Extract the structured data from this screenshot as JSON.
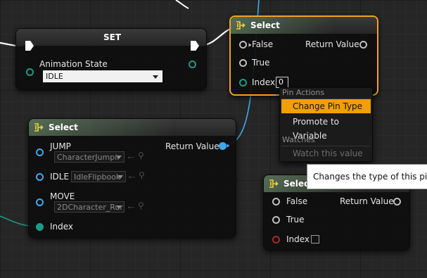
{
  "set_node": {
    "title": "SET",
    "variable_label": "Animation State",
    "variable_value": "IDLE"
  },
  "select_top": {
    "title": "Select",
    "pins": {
      "false_label": "False",
      "true_label": "True",
      "index_label": "Index",
      "index_value": "0",
      "return_label": "Return Value"
    }
  },
  "select_main": {
    "title": "Select",
    "options": [
      {
        "label": "JUMP",
        "value": "CharacterJumpir"
      },
      {
        "label": "IDLE",
        "value": "IdleFlipbook"
      },
      {
        "label": "MOVE",
        "value": "2DCharacter_Rur"
      }
    ],
    "index_label": "Index",
    "return_label": "Return Value"
  },
  "select_bottom": {
    "title": "Selec",
    "false_label": "False",
    "true_label": "True",
    "index_label": "Index",
    "return_label": "Return Value"
  },
  "context_menu": {
    "section_pin_actions": "Pin Actions",
    "change_pin_type": "Change Pin Type",
    "promote_to_variable": "Promote to Variable",
    "section_watches": "Watches",
    "watch_this_value": "Watch this value"
  },
  "tooltip": {
    "text": "Changes the type of this pin (b"
  },
  "colors": {
    "selection": "#f3a320",
    "menu_highlight": "#f0a000",
    "wire_blue": "#3ba9f0",
    "wire_teal": "#1c9a86",
    "pin_red": "#a62a26"
  },
  "icons": {
    "select_node": "select-node-icon",
    "execution_pin": "exec-pin-icon",
    "arrow_control": "arrow-left-icon",
    "browse_control": "magnifier-icon"
  }
}
